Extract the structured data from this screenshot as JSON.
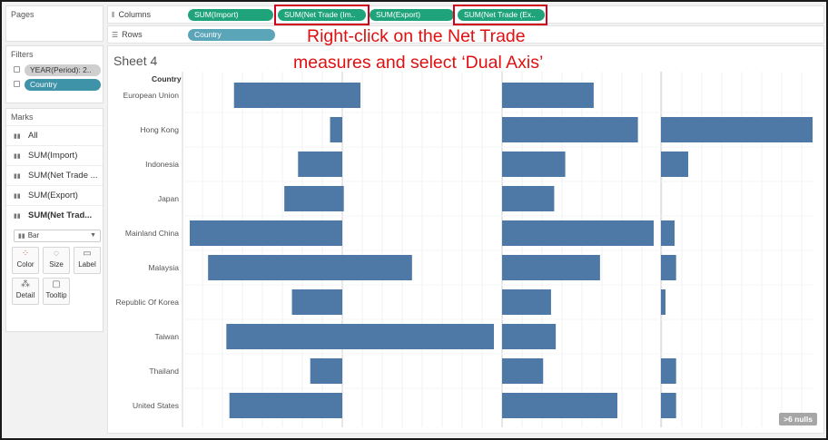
{
  "left_panel": {
    "pages_title": "Pages",
    "filters_title": "Filters",
    "filters": [
      "YEAR(Period): 2..",
      "Country"
    ],
    "marks_title": "Marks",
    "marks_rows": [
      "All",
      "SUM(Import)",
      "SUM(Net Trade ...",
      "SUM(Export)",
      "SUM(Net Trad..."
    ],
    "mark_type": "Bar",
    "mark_buttons": [
      "Color",
      "Size",
      "Label",
      "Detail",
      "Tooltip"
    ]
  },
  "shelves": {
    "columns_label": "Columns",
    "rows_label": "Rows",
    "column_pills": [
      "SUM(Import)",
      "SUM(Net Trade (Im..",
      "SUM(Export)",
      "SUM(Net Trade (Ex.."
    ],
    "row_pill": "Country"
  },
  "instruction": {
    "line1": "Right-click on the Net Trade",
    "line2": "measures and select ‘Dual Axis’"
  },
  "sheet": {
    "title": "Sheet 4",
    "row_header": "Country",
    "nulls_badge": "6 nulls"
  },
  "chart_data": {
    "type": "bar",
    "orientation": "horizontal",
    "categories": [
      "European Union",
      "Hong Kong",
      "Indonesia",
      "Japan",
      "Mainland China",
      "Malaysia",
      "Republic Of Korea",
      "Taiwan",
      "Thailand",
      "United States"
    ],
    "series": [
      {
        "name": "SUM(Import)",
        "values": [
          -0.71,
          -0.08,
          -0.29,
          -0.38,
          -1.0,
          -0.88,
          -0.33,
          -0.76,
          -0.21,
          -0.74
        ]
      },
      {
        "name": "SUM(Net Trade (Im..",
        "values": [
          0.12,
          0.0,
          0.0,
          0.01,
          0.0,
          0.46,
          0.0,
          1.0,
          0.0,
          0.0
        ]
      },
      {
        "name": "SUM(Export)",
        "values": [
          0.58,
          0.86,
          0.4,
          0.33,
          0.96,
          0.62,
          0.31,
          0.34,
          0.26,
          0.73
        ]
      },
      {
        "name": "SUM(Net Trade (Ex..",
        "values": [
          0.0,
          1.0,
          0.18,
          0.0,
          0.09,
          0.1,
          0.03,
          0.0,
          0.1,
          0.1
        ]
      }
    ],
    "bar_color": "#4e79a7"
  }
}
